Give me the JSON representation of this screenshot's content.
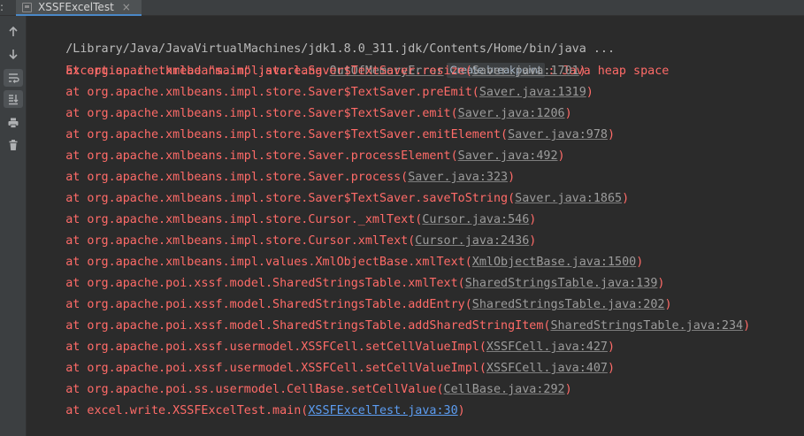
{
  "tabbar": {
    "prefix": ":",
    "tab_title": "XSSFExcelTest",
    "tab_close": "×"
  },
  "toolbar": {
    "buttons": [
      {
        "name": "up-arrow-icon"
      },
      {
        "name": "down-arrow-icon"
      },
      {
        "name": "soft-wrap-icon",
        "active": true
      },
      {
        "name": "scroll-to-end-icon",
        "active": true
      },
      {
        "name": "print-icon"
      },
      {
        "name": "trash-icon"
      }
    ]
  },
  "console": {
    "command": "/Library/Java/JavaVirtualMachines/jdk1.8.0_311.jdk/Contents/Home/bin/java ...",
    "exception": {
      "prefix": "Exception in thread \"main\" java.lang.",
      "class_link": "OutOfMemoryError",
      "hint": "Create breakpoint",
      "suffix": ": Java heap space"
    },
    "frames": [
      {
        "method": "    at org.apache.xmlbeans.impl.store.Saver$TextSaver.resize(",
        "link": "Saver.java:1701",
        "close": ")"
      },
      {
        "method": "    at org.apache.xmlbeans.impl.store.Saver$TextSaver.preEmit(",
        "link": "Saver.java:1319",
        "close": ")"
      },
      {
        "method": "    at org.apache.xmlbeans.impl.store.Saver$TextSaver.emit(",
        "link": "Saver.java:1206",
        "close": ")"
      },
      {
        "method": "    at org.apache.xmlbeans.impl.store.Saver$TextSaver.emitElement(",
        "link": "Saver.java:978",
        "close": ")"
      },
      {
        "method": "    at org.apache.xmlbeans.impl.store.Saver.processElement(",
        "link": "Saver.java:492",
        "close": ")"
      },
      {
        "method": "    at org.apache.xmlbeans.impl.store.Saver.process(",
        "link": "Saver.java:323",
        "close": ")"
      },
      {
        "method": "    at org.apache.xmlbeans.impl.store.Saver$TextSaver.saveToString(",
        "link": "Saver.java:1865",
        "close": ")"
      },
      {
        "method": "    at org.apache.xmlbeans.impl.store.Cursor._xmlText(",
        "link": "Cursor.java:546",
        "close": ")"
      },
      {
        "method": "    at org.apache.xmlbeans.impl.store.Cursor.xmlText(",
        "link": "Cursor.java:2436",
        "close": ")"
      },
      {
        "method": "    at org.apache.xmlbeans.impl.values.XmlObjectBase.xmlText(",
        "link": "XmlObjectBase.java:1500",
        "close": ")"
      },
      {
        "method": "    at org.apache.poi.xssf.model.SharedStringsTable.xmlText(",
        "link": "SharedStringsTable.java:139",
        "close": ")"
      },
      {
        "method": "    at org.apache.poi.xssf.model.SharedStringsTable.addEntry(",
        "link": "SharedStringsTable.java:202",
        "close": ")"
      },
      {
        "method": "    at org.apache.poi.xssf.model.SharedStringsTable.addSharedStringItem(",
        "link": "SharedStringsTable.java:234",
        "close": ")"
      },
      {
        "method": "    at org.apache.poi.xssf.usermodel.XSSFCell.setCellValueImpl(",
        "link": "XSSFCell.java:427",
        "close": ")"
      },
      {
        "method": "    at org.apache.poi.xssf.usermodel.XSSFCell.setCellValueImpl(",
        "link": "XSSFCell.java:407",
        "close": ")"
      },
      {
        "method": "    at org.apache.poi.ss.usermodel.CellBase.setCellValue(",
        "link": "CellBase.java:292",
        "close": ")"
      },
      {
        "method": "    at excel.write.XSSFExcelTest.main(",
        "link": "XSSFExcelTest.java:30",
        "close": ")",
        "user_code": true
      }
    ]
  },
  "colors": {
    "background": "#2b2b2b",
    "error_text": "#ff6b68",
    "command_text": "#bbbbbb",
    "library_link": "#9c9c9c",
    "user_link": "#5c9df2",
    "tab_accent": "#4a88c7"
  }
}
